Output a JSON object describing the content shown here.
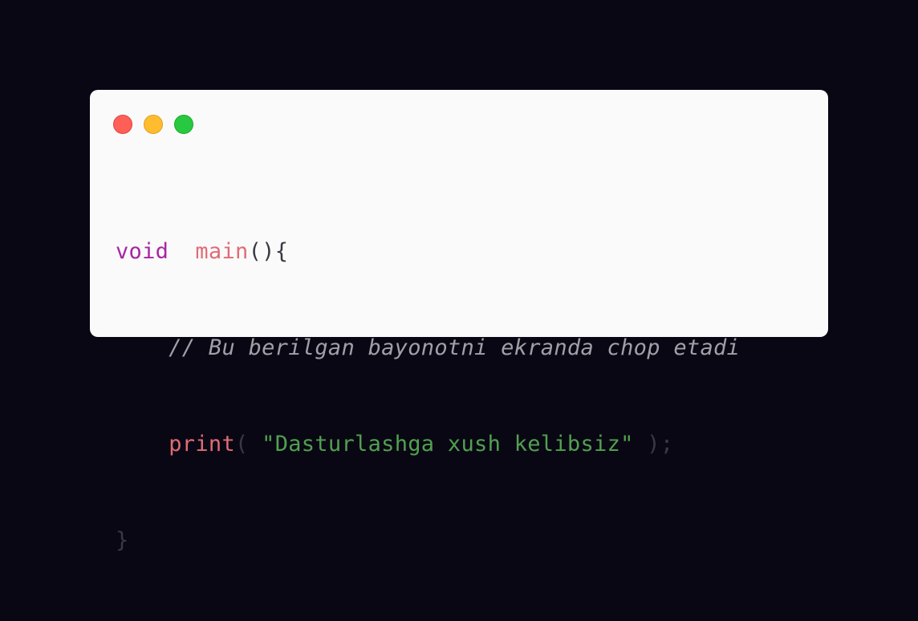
{
  "window": {
    "controls": [
      {
        "name": "close",
        "color": "#ff5f57"
      },
      {
        "name": "minimize",
        "color": "#febc2e"
      },
      {
        "name": "zoom",
        "color": "#28c840"
      }
    ]
  },
  "code": {
    "line1": {
      "keyword": "void",
      "space": "  ",
      "function": "main",
      "punct": "(){"
    },
    "line2": {
      "indent": "    ",
      "comment": "// Bu berilgan bayonotni ekranda chop etadi"
    },
    "line3": {
      "indent": "    ",
      "function": "print",
      "open": "( ",
      "string": "\"Dasturlashga xush kelibsiz\"",
      "close": " );"
    },
    "line4": {
      "punct": "}"
    }
  },
  "theme": {
    "background": "#0a0714",
    "card": "#fafafa",
    "keyword": "#a626a4",
    "function": "#e06c75",
    "string": "#50a14f",
    "comment": "#a0a1a7"
  }
}
